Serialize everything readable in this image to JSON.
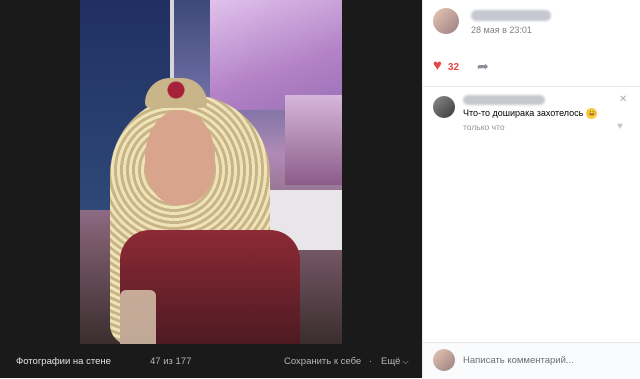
{
  "viewer": {
    "album_label": "Фотографии на стене",
    "counter": "47 из 177",
    "save_label": "Сохранить к себе",
    "separator": "·",
    "more_label": "Ещё",
    "more_chevron": "⌵"
  },
  "post": {
    "date": "28 мая в 23:01",
    "likes": "32",
    "like_icon": "♥",
    "share_icon": "➦"
  },
  "comments": [
    {
      "text": "Что-то доширака захотелось",
      "emoji": "😀",
      "time": "только что",
      "close_icon": "✕",
      "like_icon": "♥"
    }
  ],
  "comment_input": {
    "placeholder": "Написать комментарий..."
  },
  "colors": {
    "like_red": "#e64646",
    "viewer_bg": "#1a1a1a"
  }
}
